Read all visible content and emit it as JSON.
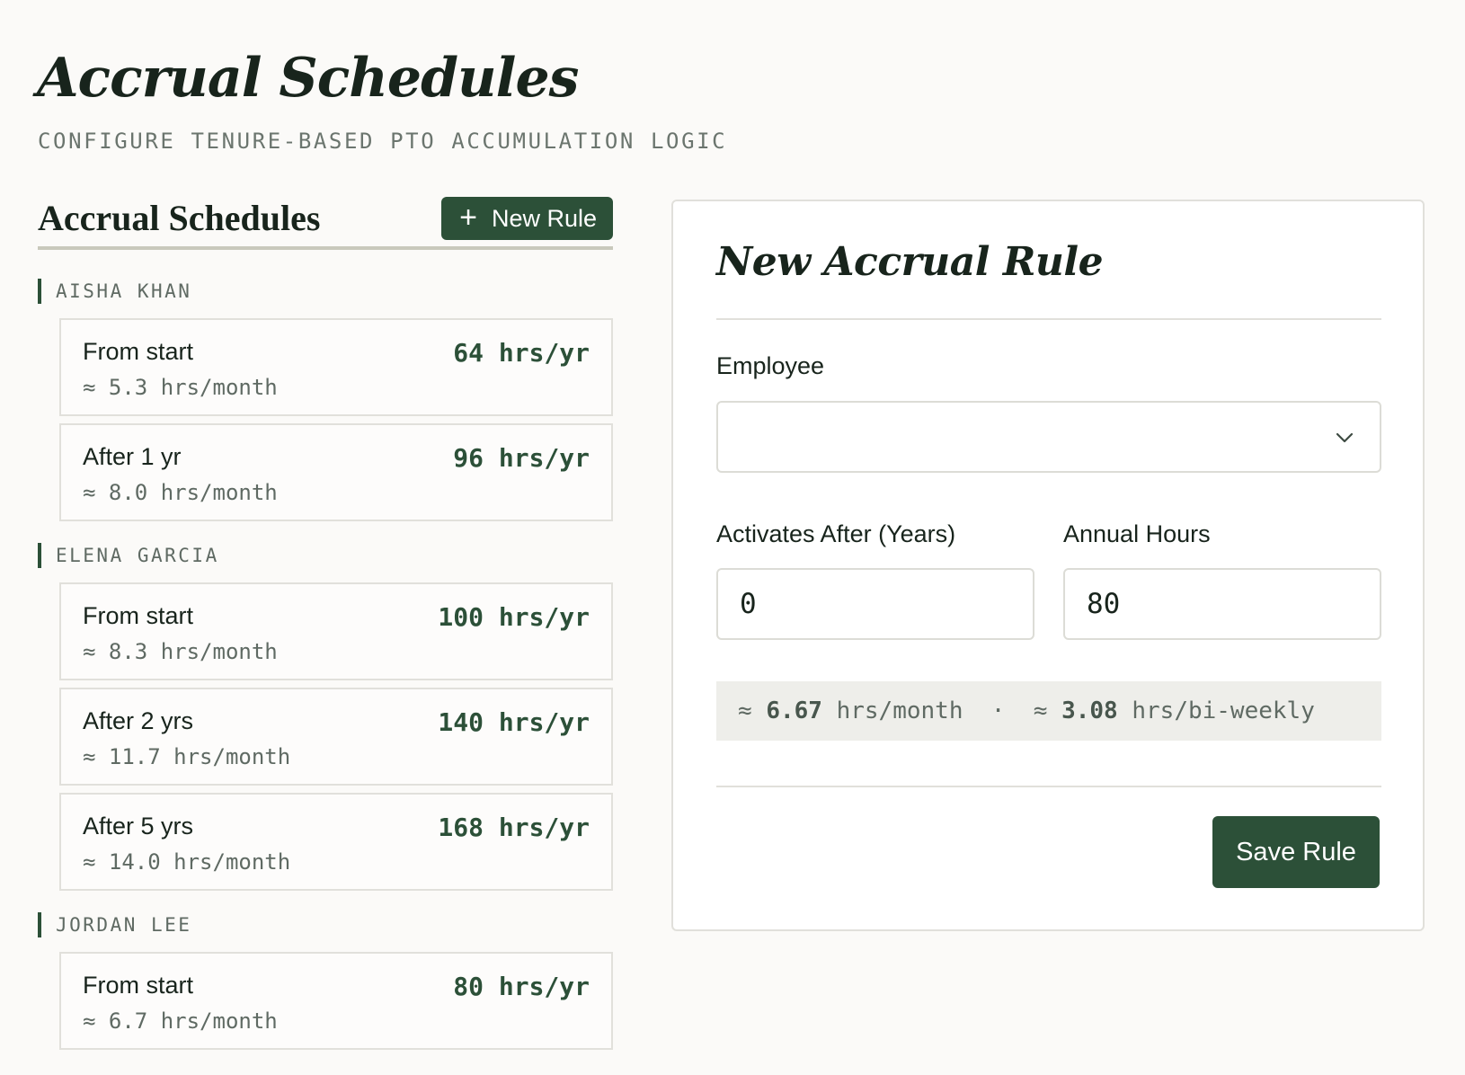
{
  "page": {
    "title": "Accrual Schedules",
    "subtitle": "CONFIGURE TENURE-BASED PTO ACCUMULATION LOGIC"
  },
  "list": {
    "heading": "Accrual Schedules",
    "new_rule_label": "New Rule",
    "groups": [
      {
        "employee": "AISHA KHAN",
        "rules": [
          {
            "title": "From start",
            "hours": "64 hrs/yr",
            "monthly": "≈ 5.3 hrs/month"
          },
          {
            "title": "After 1 yr",
            "hours": "96 hrs/yr",
            "monthly": "≈ 8.0 hrs/month"
          }
        ]
      },
      {
        "employee": "ELENA GARCIA",
        "rules": [
          {
            "title": "From start",
            "hours": "100 hrs/yr",
            "monthly": "≈ 8.3 hrs/month"
          },
          {
            "title": "After 2 yrs",
            "hours": "140 hrs/yr",
            "monthly": "≈ 11.7 hrs/month"
          },
          {
            "title": "After 5 yrs",
            "hours": "168 hrs/yr",
            "monthly": "≈ 14.0 hrs/month"
          }
        ]
      },
      {
        "employee": "JORDAN LEE",
        "rules": [
          {
            "title": "From start",
            "hours": "80 hrs/yr",
            "monthly": "≈ 6.7 hrs/month"
          }
        ]
      }
    ]
  },
  "form": {
    "title": "New Accrual Rule",
    "employee_label": "Employee",
    "employee_value": "",
    "activates_label": "Activates After (Years)",
    "activates_value": "0",
    "annual_label": "Annual Hours",
    "annual_value": "80",
    "summary": {
      "approx": "≈",
      "monthly_value": "6.67",
      "monthly_unit": "hrs/month",
      "separator": "·",
      "biweekly_value": "3.08",
      "biweekly_unit": "hrs/bi-weekly"
    },
    "save_label": "Save Rule"
  },
  "colors": {
    "accent": "#2c5038",
    "background": "#fbfaf8"
  }
}
